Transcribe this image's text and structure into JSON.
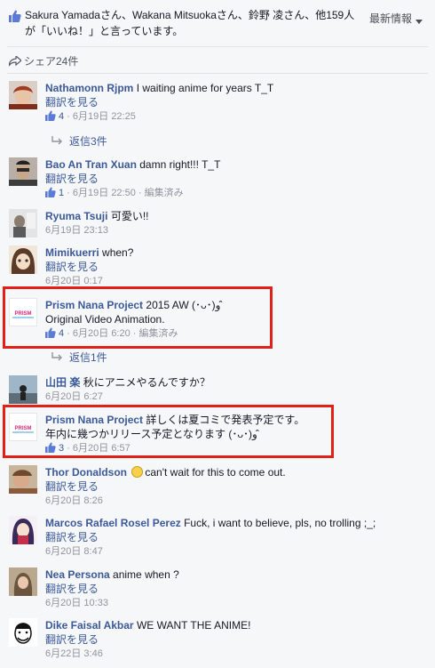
{
  "header": {
    "likes_text": "Sakura Yamadaさん、Wakana Mitsuokaさん、鈴野 凌さん、他159人が「いいね！」と言っています。",
    "sort_label": "最新情報",
    "shares_text": "シェア24件"
  },
  "common": {
    "translate": "翻訳を見る",
    "sep": " · "
  },
  "comments": [
    {
      "author": "Nathamonn Rjpm",
      "text": "I waiting anime for years T_T",
      "likes": "4",
      "time": "6月19日 22:25",
      "replies": "返信3件"
    },
    {
      "author": "Bao An Tran Xuan",
      "text": "damn right!!! T_T",
      "likes": "1",
      "time": "6月19日 22:50",
      "edited": "編集済み"
    },
    {
      "author": "Ryuma Tsuji",
      "text": "可愛い!!",
      "time": "6月19日 23:13"
    },
    {
      "author": "Mimikuerri",
      "text": "when?",
      "time": "6月20日 0:17"
    },
    {
      "author": "Prism Nana Project",
      "text": "2015 AW (･ᴗ･)و ̑̑",
      "text2": "Original Video Animation.",
      "likes": "4",
      "time": "6月20日 6:20",
      "edited": "編集済み",
      "replies": "返信1件",
      "logo": "PRISM"
    },
    {
      "author": "山田 楽",
      "text": "秋にアニメやるんですか？",
      "time": "6月20日 6:27"
    },
    {
      "author": "Prism Nana Project",
      "text": "詳しくは夏コミで発表予定です。",
      "text2": "年内に幾つかリリース予定となります (･ᴗ･)و ̑̑",
      "likes": "3",
      "time": "6月20日 6:57",
      "logo": "PRISM"
    },
    {
      "author": "Thor Donaldson",
      "text": "can't wait for this to come out.",
      "time": "6月20日 8:26"
    },
    {
      "author": "Marcos Rafael Rosel Perez",
      "text": "Fuck, i want to believe, pls, no trolling ;_;",
      "time": "6月20日 8:47"
    },
    {
      "author": "Nea Persona",
      "text": "anime when ?",
      "time": "6月20日 10:33"
    },
    {
      "author": "Dike Faisal Akbar",
      "text": "WE WANT THE ANIME!",
      "time": "6月22日 3:46"
    }
  ],
  "colors": {
    "link": "#3b5998",
    "meta": "#90949c",
    "highlight_border": "#e32018"
  },
  "icons": [
    "thumbs-up-icon",
    "share-icon",
    "reply-arrow-icon",
    "chevron-down-icon",
    "smiley-icon"
  ]
}
